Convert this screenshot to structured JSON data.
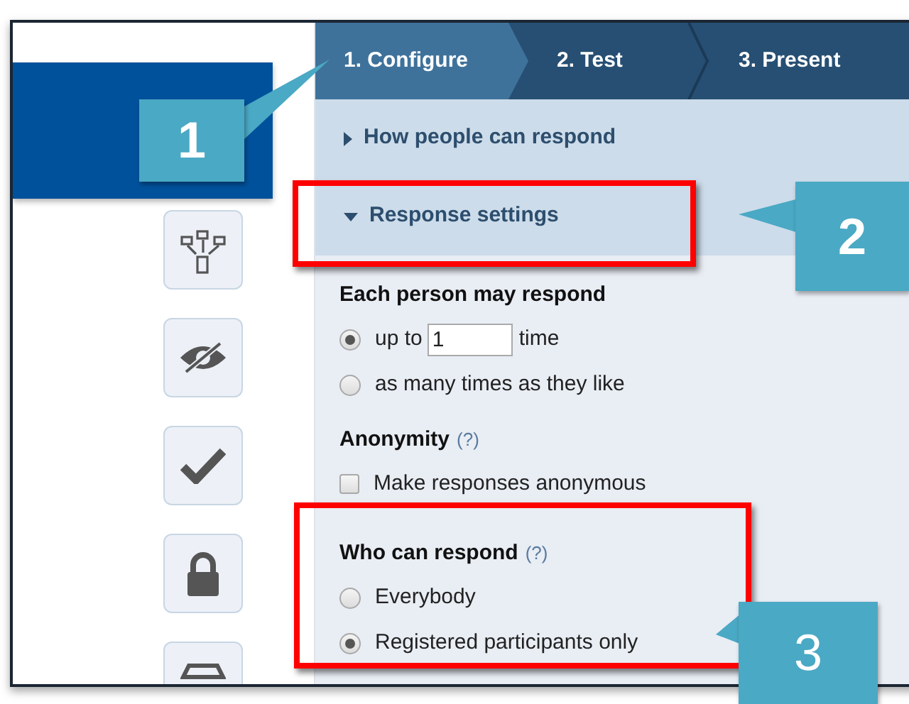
{
  "tabs": [
    {
      "label": "1. Configure",
      "selected": true
    },
    {
      "label": "2. Test",
      "selected": false
    },
    {
      "label": "3. Present",
      "selected": false
    }
  ],
  "sections": [
    {
      "title": "How people can respond",
      "expanded": false,
      "highlighted": false
    },
    {
      "title": "Response settings",
      "expanded": true,
      "highlighted": true,
      "groups": [
        {
          "heading": "Each person may respond",
          "highlighted": false,
          "options": [
            {
              "kind": "radio-input",
              "before": "up to",
              "value": "1",
              "after": "time",
              "selected": true
            },
            {
              "kind": "radio",
              "label": "as many times as they like",
              "selected": false
            }
          ]
        },
        {
          "heading": "Anonymity",
          "help": "(?)",
          "highlighted": false,
          "options": [
            {
              "kind": "checkbox",
              "label": "Make responses anonymous",
              "checked": false
            }
          ]
        },
        {
          "heading": "Who can respond",
          "help": "(?)",
          "highlighted": true,
          "options": [
            {
              "kind": "radio",
              "label": "Everybody",
              "selected": false
            },
            {
              "kind": "radio",
              "label": "Registered participants only",
              "selected": true
            }
          ]
        }
      ]
    }
  ],
  "callouts": [
    {
      "number": "1"
    },
    {
      "number": "2"
    },
    {
      "number": "3"
    }
  ]
}
